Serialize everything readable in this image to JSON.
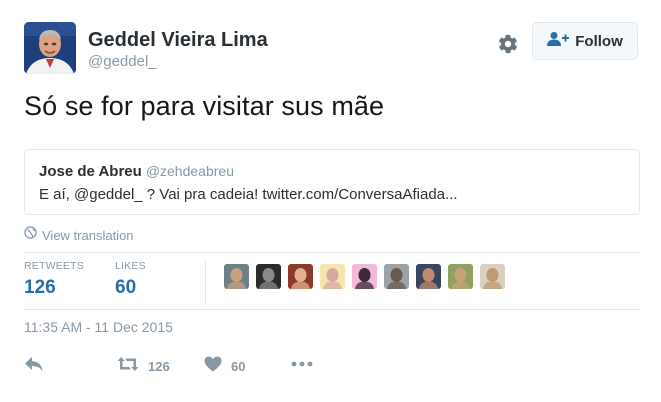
{
  "user": {
    "name": "Geddel Vieira Lima",
    "handle": "@geddel_"
  },
  "header": {
    "follow_label": "Follow",
    "icons": [
      "gear-icon",
      "follow-person-plus-icon"
    ]
  },
  "tweet": {
    "text": "Só se for para visitar sus mãe"
  },
  "quote": {
    "name": "Jose de Abreu",
    "handle": "@zehdeabreu",
    "text": "E aí, @geddel_ ? Vai pra cadeia! twitter.com/ConversaAfiada..."
  },
  "translate": {
    "label": "View translation",
    "icon": "globe-icon"
  },
  "stats": {
    "retweets_label": "RETWEETS",
    "retweets_value": "126",
    "likes_label": "LIKES",
    "likes_value": "60"
  },
  "likers": [
    {
      "bg": "#6e7f88",
      "fg": "#c9a07e"
    },
    {
      "bg": "#2c2c2c",
      "fg": "#8a8a8a"
    },
    {
      "bg": "#8b3a2a",
      "fg": "#e2b08f"
    },
    {
      "bg": "#f3e6b0",
      "fg": "#d9a8a0"
    },
    {
      "bg": "#f4b8d8",
      "fg": "#3a2a3a"
    },
    {
      "bg": "#9aa3a8",
      "fg": "#6b5a4c"
    },
    {
      "bg": "#3a4660",
      "fg": "#c08a6c"
    },
    {
      "bg": "#8fa060",
      "fg": "#c4a478"
    },
    {
      "bg": "#d8d0c0",
      "fg": "#c09a70"
    }
  ],
  "timestamp": "11:35 AM - 11 Dec 2015",
  "actions": {
    "retweet_count": "126",
    "like_count": "60",
    "icons": [
      "reply-icon",
      "retweet-icon",
      "heart-icon",
      "more-icon"
    ]
  },
  "colors": {
    "accent": "#2a6ea6",
    "muted": "#8899a6",
    "border": "#e1e8ed",
    "text": "#292f33"
  }
}
